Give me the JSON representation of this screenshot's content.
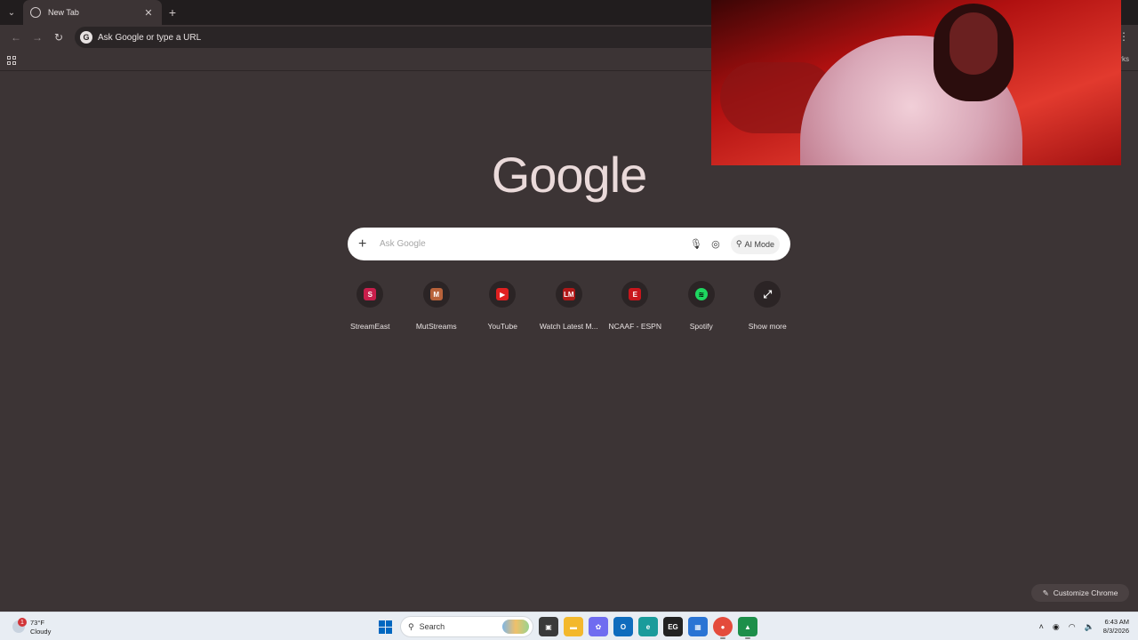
{
  "browser": {
    "tab": {
      "title": "New Tab"
    },
    "omnibox": {
      "text": "Ask Google or type a URL"
    },
    "bookmarks_right": "rks"
  },
  "page": {
    "logo": "Google",
    "search": {
      "placeholder": "Ask Google",
      "ai_mode_label": "AI Mode"
    },
    "shortcuts": [
      {
        "label": "StreamEast",
        "glyph": "S",
        "color": "#c81e4b"
      },
      {
        "label": "MutStreams",
        "glyph": "M",
        "color": "#b8623a"
      },
      {
        "label": "YouTube",
        "glyph": "▶",
        "color": "#e02020"
      },
      {
        "label": "Watch Latest M...",
        "glyph": "LM",
        "color": "#b01818"
      },
      {
        "label": "NCAAF - ESPN",
        "glyph": "E",
        "color": "#c8161c"
      },
      {
        "label": "Spotify",
        "glyph": "≋",
        "color": "#1ed760"
      },
      {
        "label": "Show more",
        "glyph": "⤢",
        "color": "#2b2425"
      }
    ],
    "customize_label": "Customize Chrome"
  },
  "taskbar": {
    "weather": {
      "temp": "73°F",
      "condition": "Cloudy",
      "badge": "1"
    },
    "search_label": "Search",
    "apps": [
      {
        "name": "task-view",
        "glyph": "▣",
        "color": "#3a3a3a"
      },
      {
        "name": "file-explorer",
        "glyph": "▬",
        "color": "#f3b82c"
      },
      {
        "name": "copilot",
        "glyph": "✿",
        "color": "#6f6cf0"
      },
      {
        "name": "outlook",
        "glyph": "O",
        "color": "#0f6cbd"
      },
      {
        "name": "edge",
        "glyph": "e",
        "color": "#1a9b9b"
      },
      {
        "name": "epic-games",
        "glyph": "EG",
        "color": "#222222"
      },
      {
        "name": "store",
        "glyph": "▦",
        "color": "#2a74d4"
      },
      {
        "name": "chrome",
        "glyph": "●",
        "color": "#e44b3c"
      },
      {
        "name": "android-studio",
        "glyph": "▲",
        "color": "#1d8f4a"
      }
    ],
    "time": "6:43 AM",
    "date": "8/3/2026"
  }
}
